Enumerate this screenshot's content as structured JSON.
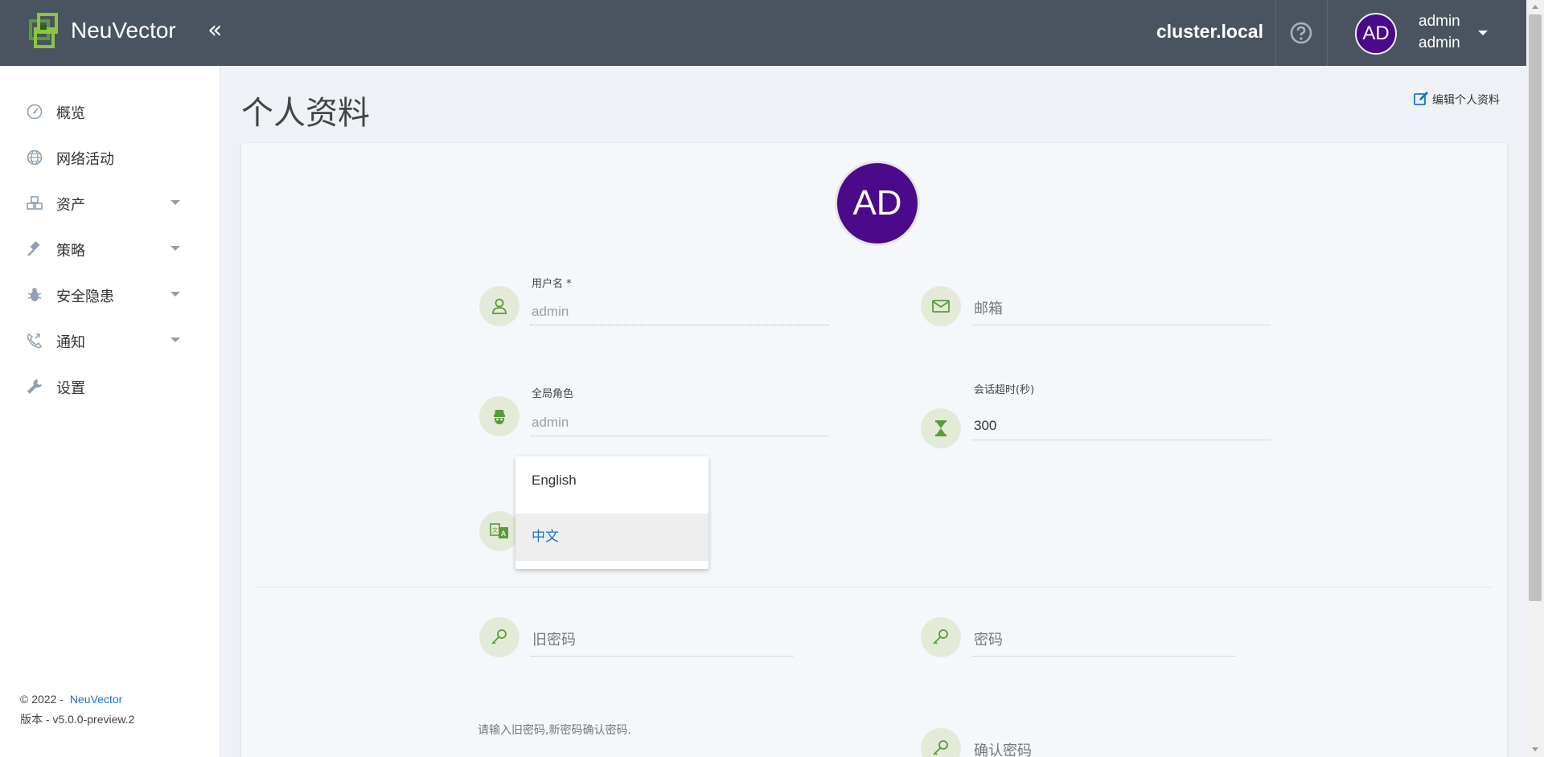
{
  "header": {
    "brand": "NeuVector",
    "collapse_glyph": "«",
    "cluster": "cluster.local",
    "avatar_initials": "AD",
    "user_name": "admin",
    "user_role": "admin",
    "icons": [
      "neuvector-logo-icon",
      "collapse-icon",
      "help-icon",
      "caret-down-icon"
    ]
  },
  "sidebar": {
    "items": [
      {
        "label": "概览",
        "icon": "dashboard-gauge-icon",
        "has_caret": false
      },
      {
        "label": "网络活动",
        "icon": "globe-icon",
        "has_caret": false
      },
      {
        "label": "资产",
        "icon": "cubes-icon",
        "has_caret": true
      },
      {
        "label": "策略",
        "icon": "gavel-icon",
        "has_caret": true
      },
      {
        "label": "安全隐患",
        "icon": "bug-icon",
        "has_caret": true
      },
      {
        "label": "通知",
        "icon": "phone-icon",
        "has_caret": true
      },
      {
        "label": "设置",
        "icon": "wrench-icon",
        "has_caret": false
      }
    ],
    "footer_copyright": "© 2022 -",
    "footer_brand": "NeuVector",
    "footer_version": "版本 - v5.0.0-preview.2"
  },
  "page": {
    "title": "个人资料",
    "edit_label": "编辑个人资料",
    "avatar_initials": "AD"
  },
  "form": {
    "username": {
      "label": "用户名 *",
      "value": "admin",
      "icon": "user-icon"
    },
    "email": {
      "placeholder": "邮箱",
      "icon": "envelope-icon"
    },
    "global_role": {
      "label": "全局角色",
      "value": "admin",
      "icon": "spy-icon"
    },
    "session_timeout": {
      "label": "会话超时(秒)",
      "value": "300",
      "icon": "hourglass-icon"
    },
    "language": {
      "icon": "translate-icon",
      "options": [
        "English",
        "中文"
      ],
      "selected": "中文"
    },
    "old_password": {
      "placeholder": "旧密码",
      "icon": "key-icon"
    },
    "new_password": {
      "placeholder": "密码",
      "icon": "key-icon"
    },
    "confirm_password": {
      "placeholder": "确认密码",
      "icon": "key-icon"
    },
    "password_hint": "请输入旧密码,新密码确认密码."
  },
  "colors": {
    "header_bg": "#4a5460",
    "avatar_bg": "#4b0a8a",
    "accent_blue": "#1a73c8",
    "icon_bg": "#e3ebd8",
    "icon_green": "#5a9a3c"
  }
}
